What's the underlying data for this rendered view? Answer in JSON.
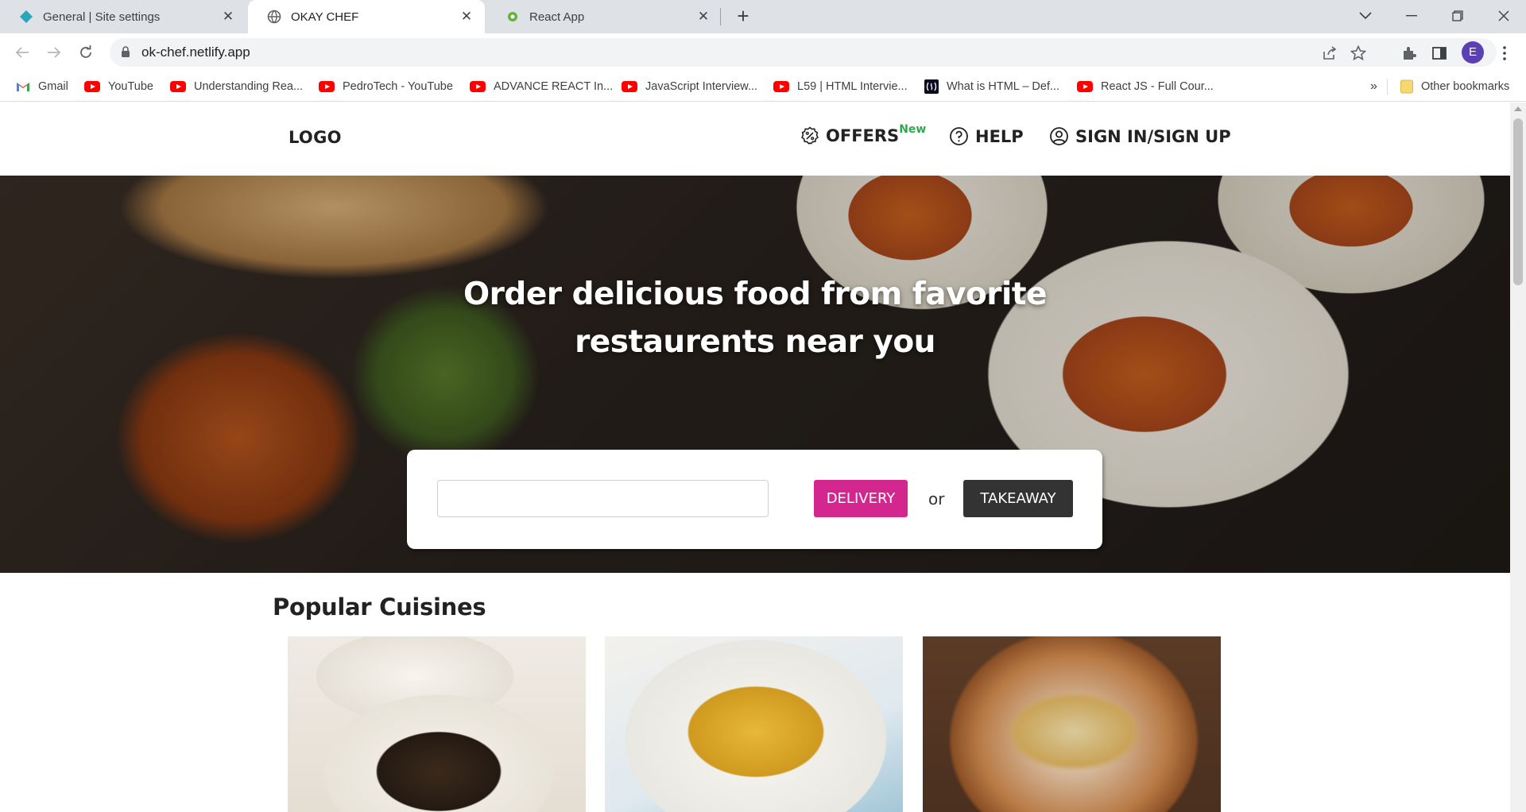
{
  "browser": {
    "tabs": [
      {
        "title": "General | Site settings",
        "active": false
      },
      {
        "title": "OKAY CHEF",
        "active": true
      },
      {
        "title": "React App",
        "active": false
      }
    ],
    "url": "ok-chef.netlify.app",
    "profile_initial": "E",
    "bookmarks": [
      {
        "label": "Gmail",
        "icon": "gmail-icon"
      },
      {
        "label": "YouTube",
        "icon": "youtube-icon"
      },
      {
        "label": "Understanding Rea...",
        "icon": "youtube-icon"
      },
      {
        "label": "PedroTech - YouTube",
        "icon": "youtube-icon"
      },
      {
        "label": "ADVANCE REACT In...",
        "icon": "youtube-icon"
      },
      {
        "label": "JavaScript Interview...",
        "icon": "youtube-icon"
      },
      {
        "label": "L59 | HTML Intervie...",
        "icon": "youtube-icon"
      },
      {
        "label": "What is HTML – Def...",
        "icon": "freecodecamp-icon"
      },
      {
        "label": "React JS - Full Cour...",
        "icon": "youtube-icon"
      }
    ],
    "overflow_label": "»",
    "other_bookmarks": "Other bookmarks"
  },
  "site": {
    "logo": "LOGO",
    "nav": {
      "offers": "OFFERS",
      "offers_badge": "New",
      "help": "HELP",
      "signin": "SIGN IN/SIGN UP"
    },
    "hero": {
      "title": "Order delicious food from favorite restaurents near you"
    },
    "search": {
      "value": "",
      "delivery_label": "DELIVERY",
      "or_label": "or",
      "takeaway_label": "TAKEAWAY"
    },
    "section_title": "Popular Cuisines"
  },
  "colors": {
    "accent": "#d4268f",
    "dark_button": "#333333",
    "badge_green": "#2fa84f"
  }
}
